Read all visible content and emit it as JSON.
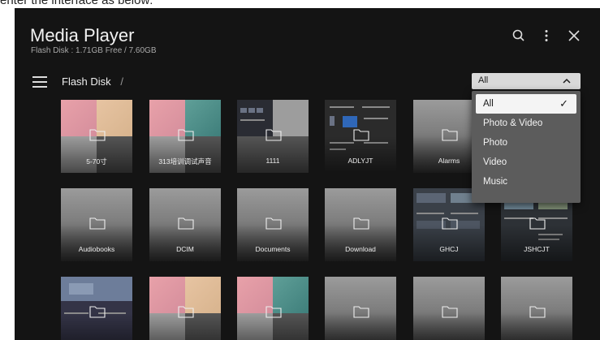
{
  "caption": "enter the interface as below:",
  "app": {
    "title": "Media Player",
    "subtitle": "Flash Disk : 1.71GB Free / 7.60GB"
  },
  "breadcrumb": {
    "label": "Flash Disk",
    "separator": "/"
  },
  "filter": {
    "selected": "All",
    "options": [
      "All",
      "Photo & Video",
      "Photo",
      "Video",
      "Music"
    ],
    "check": "✓"
  },
  "tiles": [
    {
      "label": "5-70寸"
    },
    {
      "label": "313培训调试声音"
    },
    {
      "label": "1111"
    },
    {
      "label": "ADLYJT"
    },
    {
      "label": "Alarms"
    },
    {
      "label": ""
    },
    {
      "label": "Audiobooks"
    },
    {
      "label": "DCIM"
    },
    {
      "label": "Documents"
    },
    {
      "label": "Download"
    },
    {
      "label": "GHCJ"
    },
    {
      "label": "JSHCJT"
    },
    {
      "label": ""
    },
    {
      "label": ""
    },
    {
      "label": ""
    },
    {
      "label": ""
    },
    {
      "label": ""
    },
    {
      "label": ""
    }
  ],
  "colors": {
    "background": "#141414",
    "accent": "#f4f4f4"
  }
}
